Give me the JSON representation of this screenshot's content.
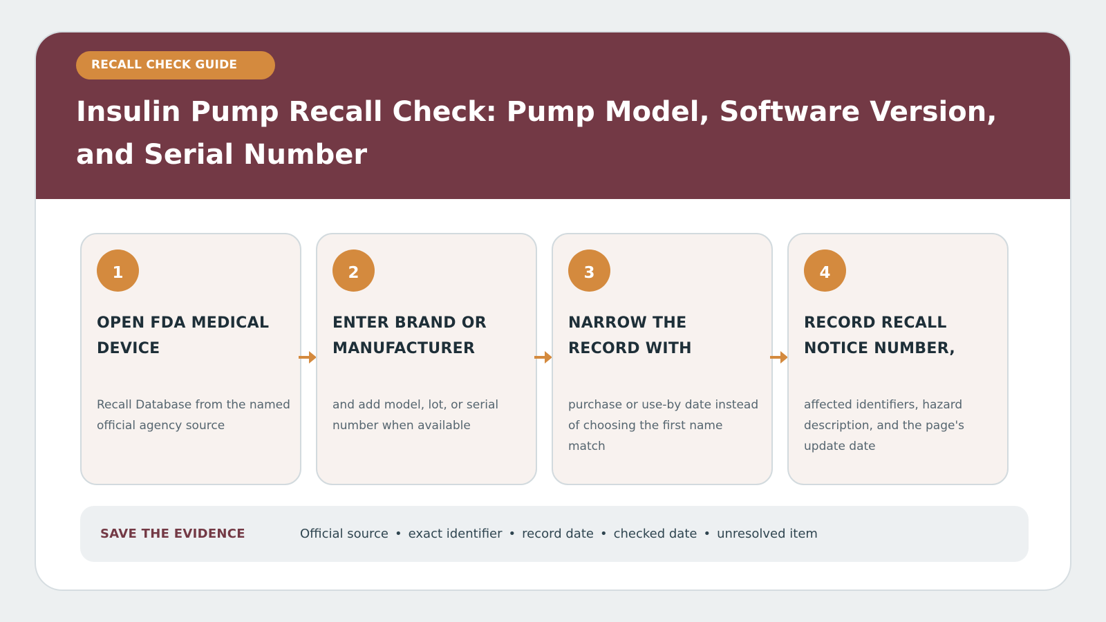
{
  "header": {
    "badge": "RECALL CHECK GUIDE",
    "title": "Insulin Pump Recall Check: Pump Model, Software Version, and Serial Number"
  },
  "steps": [
    {
      "number": "1",
      "heading": "OPEN FDA MEDICAL DEVICE",
      "description": "Recall Database from the named official agency source"
    },
    {
      "number": "2",
      "heading": "ENTER BRAND OR MANUFACTURER",
      "description": "and add model, lot, or serial number when available"
    },
    {
      "number": "3",
      "heading": "NARROW THE RECORD WITH",
      "description": "purchase or use-by date instead of choosing the first name match"
    },
    {
      "number": "4",
      "heading": "RECORD RECALL NOTICE NUMBER,",
      "description": "affected identifiers, hazard description, and the page's update date"
    }
  ],
  "evidence": {
    "label": "SAVE THE EVIDENCE",
    "items": [
      "Official source",
      "exact identifier",
      "record date",
      "checked date",
      "unresolved item"
    ],
    "separator": "•"
  },
  "colors": {
    "header_bg": "#733945",
    "accent": "#d48a3e",
    "step_bg": "#f8f2ef",
    "heading_text": "#1e2f38"
  },
  "icons": {
    "connector": "arrow-right-icon"
  }
}
